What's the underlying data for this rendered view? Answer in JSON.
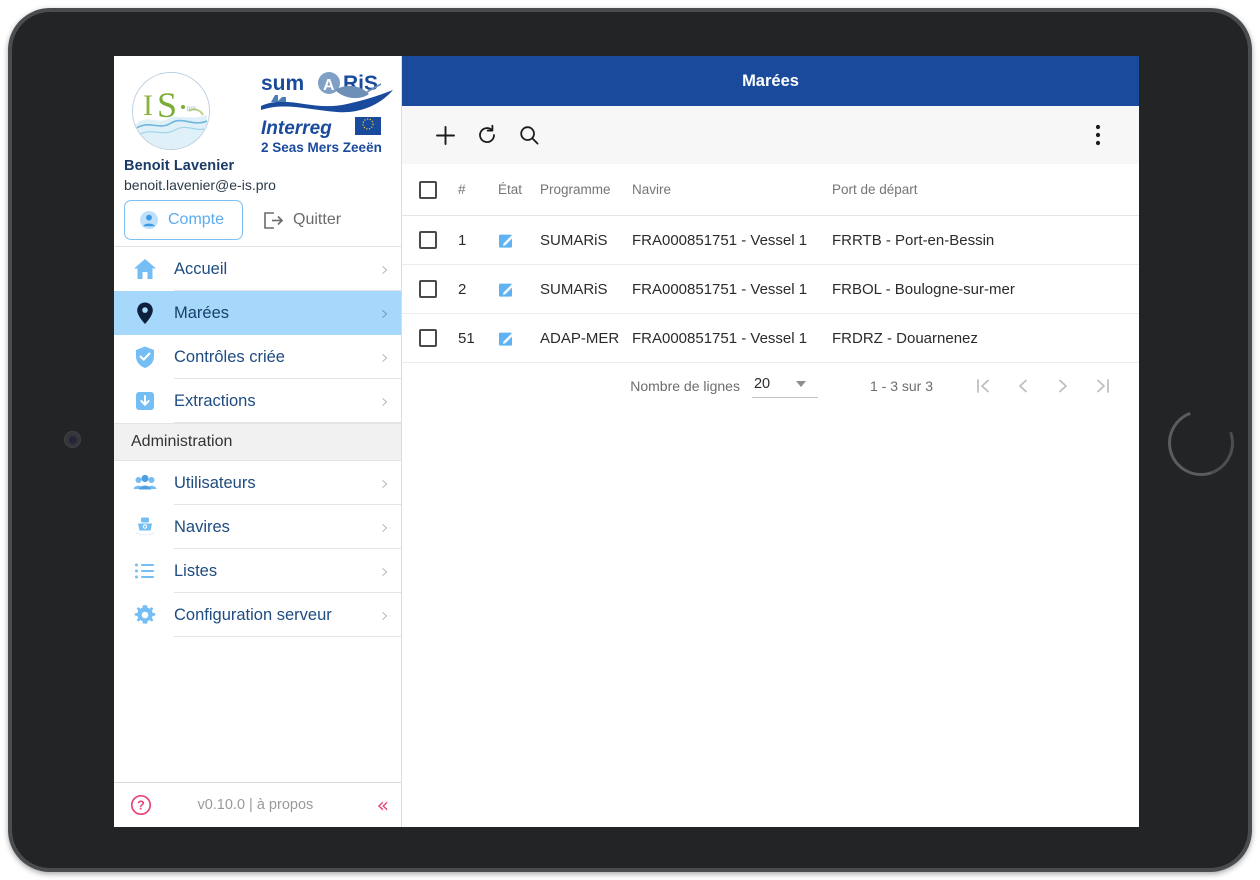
{
  "app": {
    "title": "Marées"
  },
  "user": {
    "name": "Benoit Lavenier",
    "email": "benoit.lavenier@e-is.pro",
    "account_button": "Compte",
    "logout_button": "Quitter",
    "avatar_icon": "sumaris-wave-avatar",
    "brand_logo": "sumaris-interreg-logo",
    "brand_text_main": "SUM A RiS",
    "brand_text_sub": "Interreg",
    "brand_text_sub2": "2 Seas Mers Zeeën"
  },
  "sidebar": {
    "items": [
      {
        "label": "Accueil",
        "icon": "home-icon",
        "active": false
      },
      {
        "label": "Marées",
        "icon": "location-pin-icon",
        "active": true
      },
      {
        "label": "Contrôles criée",
        "icon": "shield-check-icon",
        "active": false
      },
      {
        "label": "Extractions",
        "icon": "download-box-icon",
        "active": false
      }
    ],
    "section_label": "Administration",
    "admin_items": [
      {
        "label": "Utilisateurs",
        "icon": "users-icon"
      },
      {
        "label": "Navires",
        "icon": "boat-icon"
      },
      {
        "label": "Listes",
        "icon": "list-icon"
      },
      {
        "label": "Configuration serveur",
        "icon": "gear-icon"
      }
    ],
    "footer": {
      "help_icon": "help-circle-icon",
      "version": "v0.10.0 | à propos",
      "collapse_icon": "chevron-double-left-icon"
    }
  },
  "toolbar": {
    "add_icon": "plus-icon",
    "refresh_icon": "refresh-icon",
    "search_icon": "search-icon",
    "more_icon": "more-vertical-icon"
  },
  "table": {
    "columns": [
      {
        "key": "check",
        "label": ""
      },
      {
        "key": "num",
        "label": "#"
      },
      {
        "key": "etat",
        "label": "État"
      },
      {
        "key": "programme",
        "label": "Programme"
      },
      {
        "key": "navire",
        "label": "Navire"
      },
      {
        "key": "port",
        "label": "Port de départ"
      }
    ],
    "rows": [
      {
        "num": "1",
        "etat_icon": "edit-pencil-icon",
        "programme": "SUMARiS",
        "navire": "FRA000851751 - Vessel 1",
        "port": "FRRTB - Port-en-Bessin"
      },
      {
        "num": "2",
        "etat_icon": "edit-pencil-icon",
        "programme": "SUMARiS",
        "navire": "FRA000851751 - Vessel 1",
        "port": "FRBOL - Boulogne-sur-mer"
      },
      {
        "num": "51",
        "etat_icon": "edit-pencil-icon",
        "programme": "ADAP-MER",
        "navire": "FRA000851751 - Vessel 1",
        "port": "FRDRZ - Douarnenez"
      }
    ]
  },
  "pagination": {
    "rows_label": "Nombre de lignes",
    "rows_value": "20",
    "range_text": "1 - 3 sur 3",
    "first_icon": "first-page-icon",
    "prev_icon": "prev-page-icon",
    "next_icon": "next-page-icon",
    "last_icon": "last-page-icon"
  },
  "colors": {
    "header_blue": "#1a4a9c",
    "active_item": "#a5d8fb",
    "icon_blue": "#74bdf5",
    "link_blue": "#1e4b80",
    "accent_pink": "#e4467f"
  }
}
